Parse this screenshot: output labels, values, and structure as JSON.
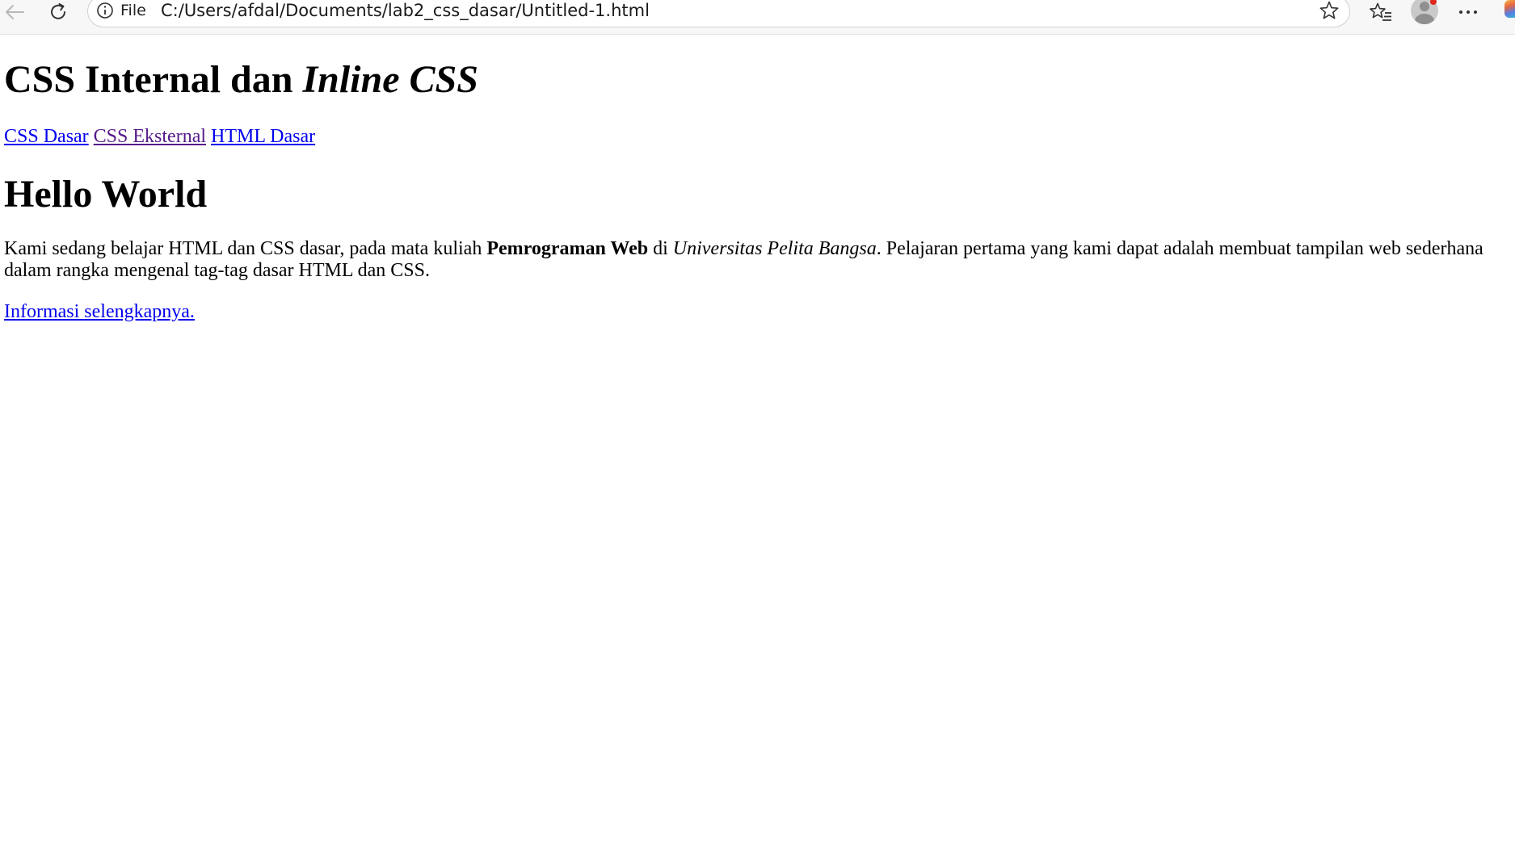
{
  "browser": {
    "site_info_label": "File",
    "url": "C:/Users/afdal/Documents/lab2_css_dasar/Untitled-1.html",
    "icons": [
      "back-arrow-icon",
      "reload-icon",
      "info-icon",
      "star-icon",
      "favorites-icon",
      "profile-avatar-icon",
      "more-options-icon",
      "copilot-icon"
    ],
    "colors": {
      "notification_dot": "#e0261b",
      "link": "#0000ee",
      "visited_link": "#551a8b"
    }
  },
  "page": {
    "title_part1": "CSS Internal dan ",
    "title_italic": "Inline CSS",
    "nav": {
      "link1": "CSS Dasar",
      "link2": "CSS Eksternal",
      "link3": "HTML Dasar"
    },
    "heading": "Hello World",
    "paragraph": {
      "part1": "Kami sedang belajar HTML dan CSS dasar, pada mata kuliah ",
      "bold": "Pemrograman Web",
      "part2": " di ",
      "italic": "Universitas Pelita Bangsa",
      "part3": ". Pelajaran pertama yang kami dapat adalah membuat tampilan web sederhana dalam rangka mengenal tag-tag dasar HTML dan CSS."
    },
    "more_link": "Informasi selengkapnya."
  }
}
